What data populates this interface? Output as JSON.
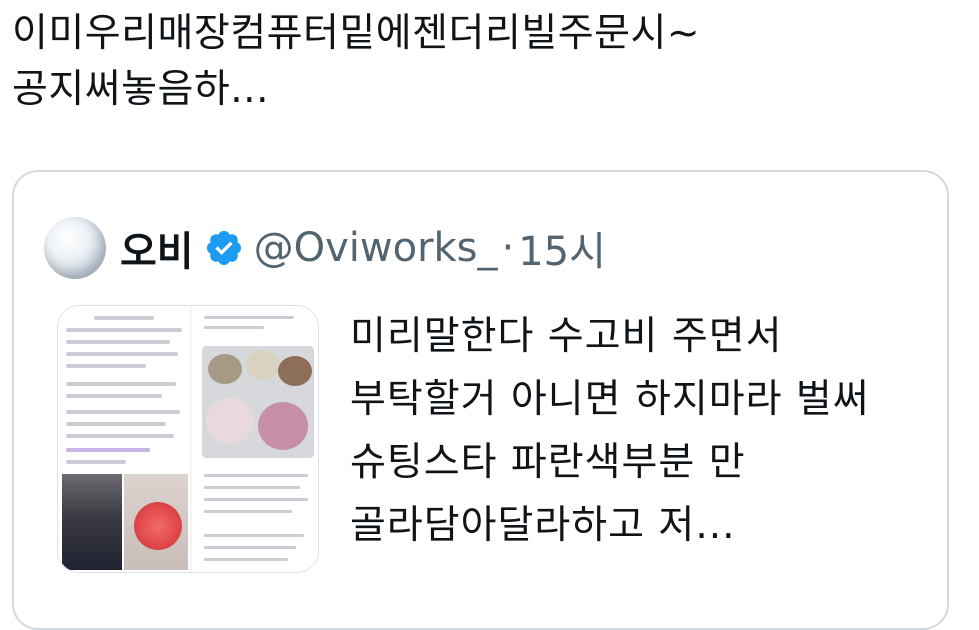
{
  "tweet": {
    "text": "이미우리매장컴퓨터밑에젠더리빌주문시~ 공지써놓음하..."
  },
  "quoted_tweet": {
    "display_name": "오비",
    "handle": "@Oviworks_",
    "separator": "·",
    "time": "15시",
    "verified": true,
    "text": "미리말한다 수고비 주면서 부탁할거 아니면 하지마라 벌써 슈팅스타 파란색부분 만 골라담아달라하고 저..."
  },
  "colors": {
    "text": "#0f1419",
    "secondary": "#536471",
    "border": "#cfd9de",
    "verified": "#1d9bf0"
  }
}
